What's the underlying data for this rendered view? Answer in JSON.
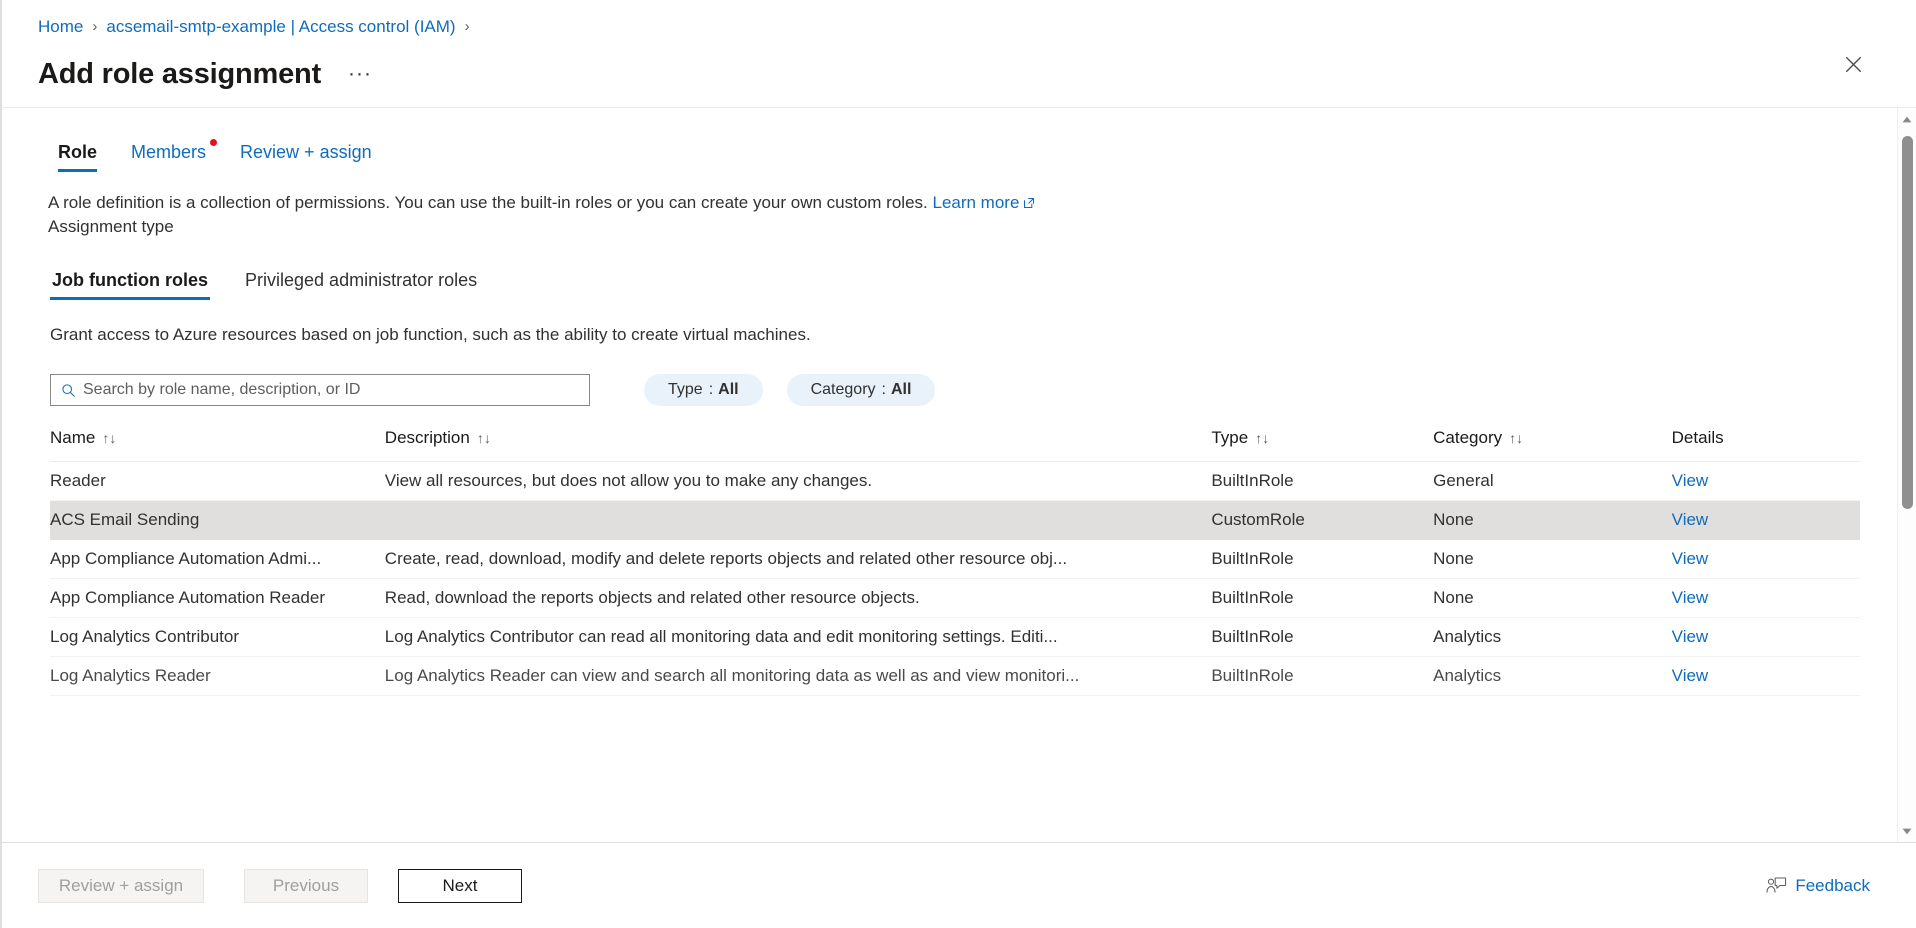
{
  "breadcrumb": {
    "items": [
      {
        "label": "Home"
      },
      {
        "label": "acsemail-smtp-example | Access control (IAM)"
      }
    ],
    "separator": "›"
  },
  "header": {
    "title": "Add role assignment",
    "more_label": "···",
    "close_icon": "close-icon"
  },
  "tabs": [
    {
      "label": "Role",
      "selected": true,
      "required_dot": false
    },
    {
      "label": "Members",
      "selected": false,
      "required_dot": true
    },
    {
      "label": "Review + assign",
      "selected": false,
      "required_dot": false
    }
  ],
  "description": {
    "text": "A role definition is a collection of permissions. You can use the built-in roles or you can create your own custom roles.",
    "link_label": "Learn more",
    "assignment_type_label": "Assignment type"
  },
  "sub_tabs": [
    {
      "label": "Job function roles",
      "selected": true
    },
    {
      "label": "Privileged administrator roles",
      "selected": false
    }
  ],
  "sub_description": "Grant access to Azure resources based on job function, such as the ability to create virtual machines.",
  "search": {
    "placeholder": "Search by role name, description, or ID",
    "value": "",
    "icon": "search-icon"
  },
  "filters": [
    {
      "name": "Type",
      "separator": ":",
      "value": "All"
    },
    {
      "name": "Category",
      "separator": ":",
      "value": "All"
    }
  ],
  "table": {
    "columns": [
      {
        "label": "Name",
        "sortable": true
      },
      {
        "label": "Description",
        "sortable": true
      },
      {
        "label": "Type",
        "sortable": true
      },
      {
        "label": "Category",
        "sortable": true
      },
      {
        "label": "Details",
        "sortable": false
      }
    ],
    "sort_icon": "↑↓",
    "detail_link_label": "View",
    "rows": [
      {
        "name": "Reader",
        "description": "View all resources, but does not allow you to make any changes.",
        "type": "BuiltInRole",
        "category": "General",
        "details": "View",
        "selected": false
      },
      {
        "name": "ACS Email Sending",
        "description": "",
        "type": "CustomRole",
        "category": "None",
        "details": "View",
        "selected": true
      },
      {
        "name": "App Compliance Automation Admi...",
        "description": "Create, read, download, modify and delete reports objects and related other resource obj...",
        "type": "BuiltInRole",
        "category": "None",
        "details": "View",
        "selected": false
      },
      {
        "name": "App Compliance Automation Reader",
        "description": "Read, download the reports objects and related other resource objects.",
        "type": "BuiltInRole",
        "category": "None",
        "details": "View",
        "selected": false
      },
      {
        "name": "Log Analytics Contributor",
        "description": "Log Analytics Contributor can read all monitoring data and edit monitoring settings. Editi...",
        "type": "BuiltInRole",
        "category": "Analytics",
        "details": "View",
        "selected": false
      },
      {
        "name": "Log Analytics Reader",
        "description": "Log Analytics Reader can view and search all monitoring data as well as and view monitori...",
        "type": "BuiltInRole",
        "category": "Analytics",
        "details": "View",
        "selected": false
      }
    ]
  },
  "footer": {
    "review_assign_label": "Review + assign",
    "previous_label": "Previous",
    "next_label": "Next",
    "feedback_label": "Feedback"
  },
  "scrollbar": {
    "up_icon": "chevron-up-icon",
    "down_icon": "chevron-down-icon"
  },
  "colors": {
    "accent": "#0f6cbd",
    "required_dot": "#e81123",
    "selected_row": "#e1dfdd",
    "pill_bg": "#e9f2fb"
  }
}
